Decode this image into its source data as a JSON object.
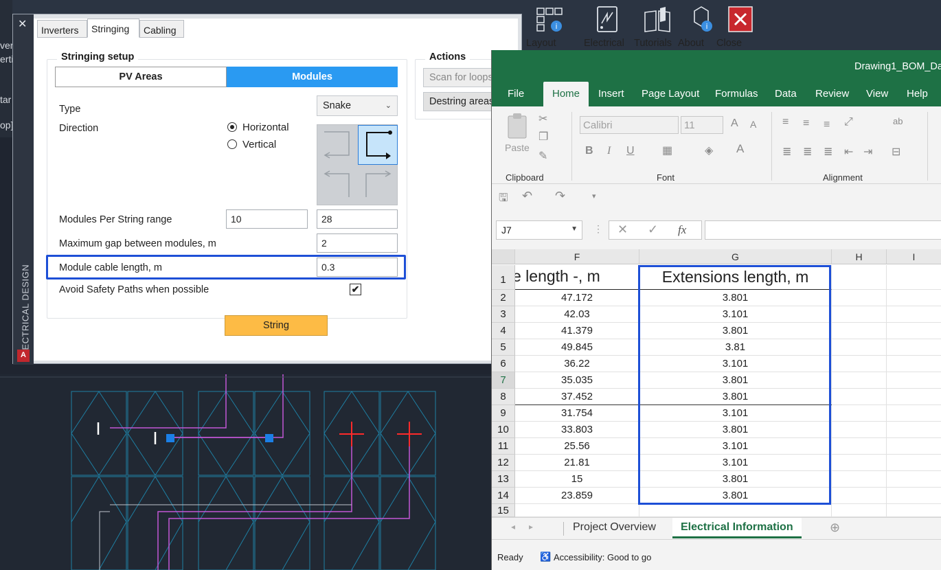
{
  "cad": {
    "ribbon_buttons": [
      {
        "label": "Layout",
        "icon": "layout-icon"
      },
      {
        "label": "Electrical",
        "icon": "electrical-icon"
      },
      {
        "label": "Tutorials",
        "icon": "book-icon"
      },
      {
        "label": "About",
        "icon": "info-icon"
      },
      {
        "label": "Close",
        "icon": "close-icon"
      }
    ],
    "left_fragments": [
      "ver",
      "erti",
      "tar",
      "op]"
    ]
  },
  "palette": {
    "vertical_title": "ELECTRICAL DESIGN",
    "close_glyph": "✕",
    "logo_text": "A",
    "tabs": [
      {
        "label": "Inverters",
        "active": false
      },
      {
        "label": "Stringing",
        "active": true
      },
      {
        "label": "Cabling",
        "active": false
      }
    ],
    "setup": {
      "title": "Stringing setup",
      "segments": [
        {
          "label": "PV Areas",
          "active": false
        },
        {
          "label": "Modules",
          "active": true
        }
      ],
      "type_label": "Type",
      "type_value": "Snake",
      "direction_label": "Direction",
      "direction_options": [
        {
          "label": "Horizontal",
          "selected": true
        },
        {
          "label": "Vertical",
          "selected": false
        }
      ],
      "modules_per_string_label": "Modules Per String range",
      "modules_per_string_min": "10",
      "modules_per_string_max": "28",
      "max_gap_label": "Maximum gap between modules, m",
      "max_gap_value": "2",
      "module_cable_label": "Module cable length, m",
      "module_cable_value": "0.3",
      "avoid_safety_label": "Avoid Safety Paths when possible",
      "avoid_safety_checked": true,
      "check_glyph": "✔",
      "string_button": "String"
    },
    "actions": {
      "title": "Actions",
      "scan_button": "Scan for loops",
      "destring_button": "Destring areas"
    }
  },
  "excel": {
    "title": "Drawing1_BOM_Da",
    "menus": [
      "File",
      "Home",
      "Insert",
      "Page Layout",
      "Formulas",
      "Data",
      "Review",
      "View",
      "Help"
    ],
    "active_menu": "Home",
    "ribbon": {
      "paste_label": "Paste",
      "font_name": "Calibri",
      "font_size": "11",
      "groups": [
        "Clipboard",
        "Font",
        "Alignment"
      ],
      "bold": "B",
      "italic": "I",
      "underline": "U",
      "fx": "fx"
    },
    "name_box": "J7",
    "columns": [
      "F",
      "G",
      "H",
      "I"
    ],
    "rows": [
      {
        "num": "1",
        "f": "e length -, m",
        "g": "Extensions length, m"
      },
      {
        "num": "2",
        "f": "47.172",
        "g": "3.801"
      },
      {
        "num": "3",
        "f": "42.03",
        "g": "3.101"
      },
      {
        "num": "4",
        "f": "41.379",
        "g": "3.801"
      },
      {
        "num": "5",
        "f": "49.845",
        "g": "3.81"
      },
      {
        "num": "6",
        "f": "36.22",
        "g": "3.101"
      },
      {
        "num": "7",
        "f": "35.035",
        "g": "3.801"
      },
      {
        "num": "8",
        "f": "37.452",
        "g": "3.801"
      },
      {
        "num": "9",
        "f": "31.754",
        "g": "3.101"
      },
      {
        "num": "10",
        "f": "33.803",
        "g": "3.801"
      },
      {
        "num": "11",
        "f": "25.56",
        "g": "3.101"
      },
      {
        "num": "12",
        "f": "21.81",
        "g": "3.101"
      },
      {
        "num": "13",
        "f": "15",
        "g": "3.801"
      },
      {
        "num": "14",
        "f": "23.859",
        "g": "3.801"
      },
      {
        "num": "15",
        "f": "",
        "g": ""
      }
    ],
    "sheets": [
      {
        "label": "Project Overview",
        "active": false
      },
      {
        "label": "Electrical Information",
        "active": true
      }
    ],
    "status_ready": "Ready",
    "status_accessibility": "Accessibility: Good to go"
  },
  "colors": {
    "excel_green": "#1e7145",
    "accent_blue": "#2a9af2",
    "highlight_blue": "#1d4fd6",
    "string_orange": "#fdbb45"
  }
}
